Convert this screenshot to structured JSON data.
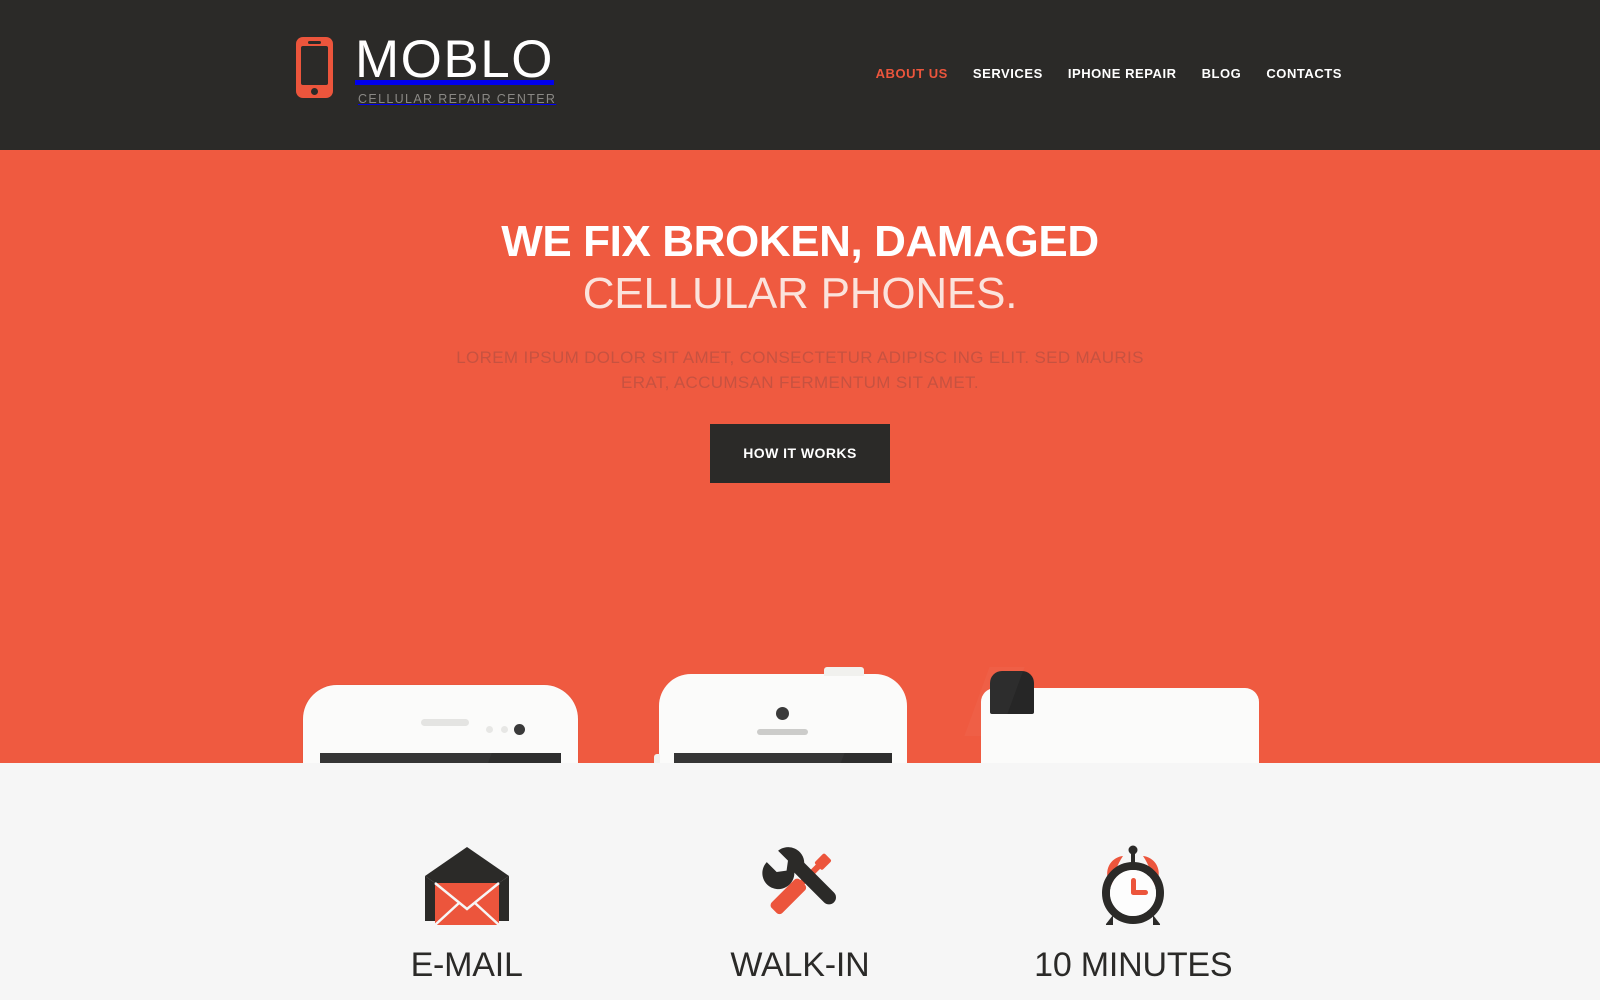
{
  "header": {
    "logo_icon": "mobile-phone-icon",
    "brand_name": "MOBLO",
    "brand_tagline": "CELLULAR REPAIR CENTER",
    "nav": [
      {
        "label": "ABOUT US",
        "active": true
      },
      {
        "label": "SERVICES",
        "active": false
      },
      {
        "label": "IPHONE REPAIR",
        "active": false
      },
      {
        "label": "BLOG",
        "active": false
      },
      {
        "label": "CONTACTS",
        "active": false
      }
    ]
  },
  "hero": {
    "headline_line1": "WE FIX BROKEN, DAMAGED",
    "headline_line2": "CELLULAR PHONES.",
    "subtitle_line1": "LOREM IPSUM DOLOR SIT AMET, CONSECTETUR ADIPISC ING ELIT. SED MAURIS",
    "subtitle_line2": "ERAT, ACCUMSAN FERMENTUM SIT AMET.",
    "cta_label": "HOW IT WORKS",
    "devices": [
      {
        "name": "android-phone"
      },
      {
        "name": "iphone"
      },
      {
        "name": "tablet"
      }
    ]
  },
  "features": [
    {
      "icon": "envelope-icon",
      "title": "E-MAIL"
    },
    {
      "icon": "wrench-screwdriver-icon",
      "title": "WALK-IN"
    },
    {
      "icon": "alarm-clock-icon",
      "title": "10 MINUTES"
    }
  ],
  "colors": {
    "accent": "#ef5a40",
    "accent_logo": "#ec553c",
    "dark": "#2b2a28",
    "light_bg": "#f6f6f6",
    "subtitle": "#c75240",
    "headline_light": "#fbe3dc"
  }
}
